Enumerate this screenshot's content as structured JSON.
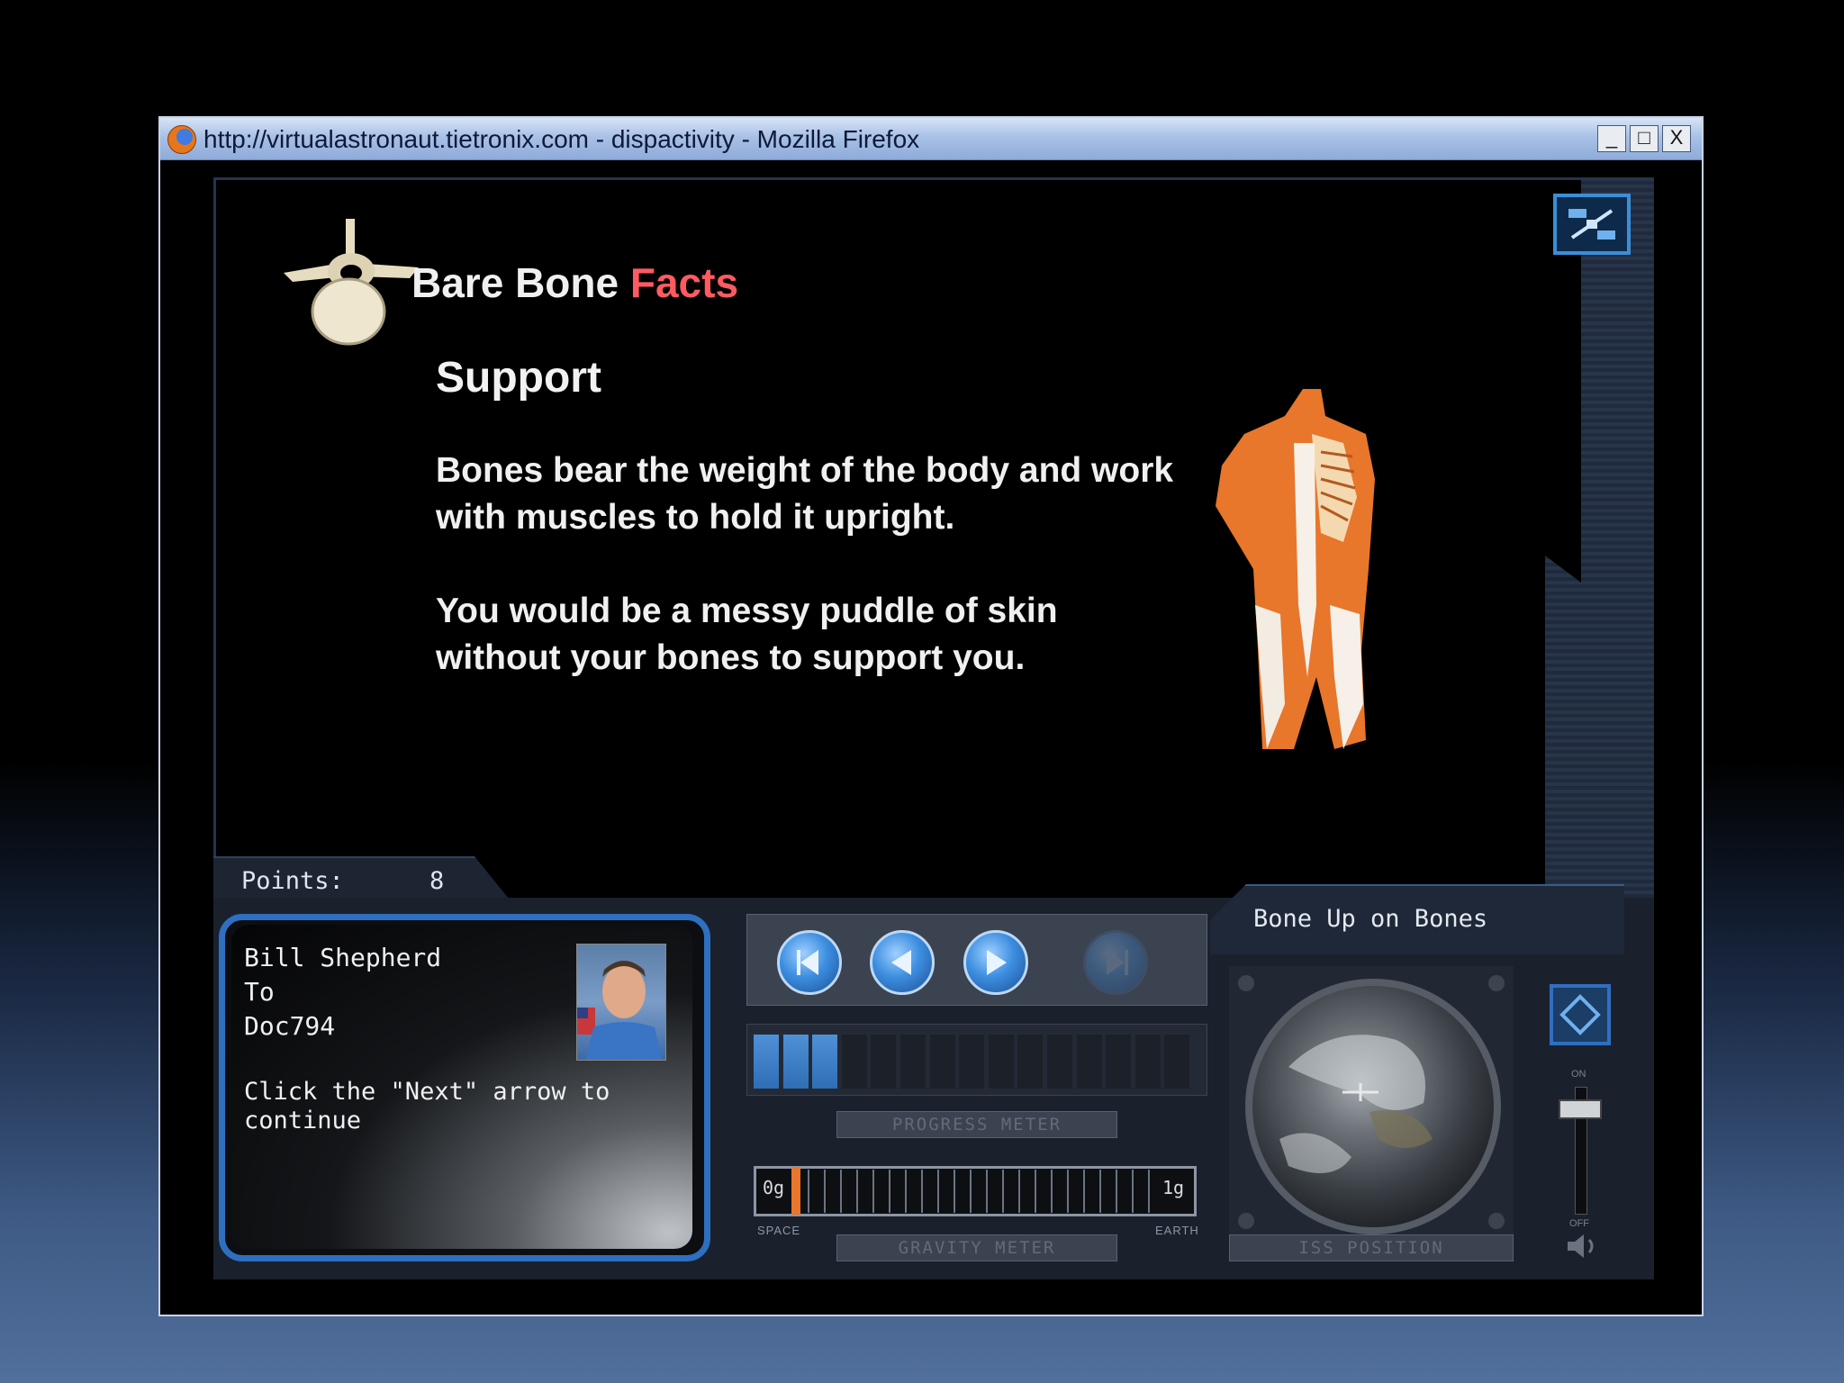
{
  "browser": {
    "title": "http://virtualastronaut.tietronix.com - dispactivity - Mozilla Firefox",
    "controls": {
      "minimize": "_",
      "maximize": "□",
      "close": "X"
    }
  },
  "lesson": {
    "heading_main": "Bare Bone ",
    "heading_highlight": "Facts",
    "subheading": "Support",
    "paragraph_1": "Bones bear the weight of the body and work with muscles to hold it upright.",
    "paragraph_2": "You would be a messy puddle of skin without your bones to support you."
  },
  "points": {
    "label": "Points:",
    "value": "8"
  },
  "message": {
    "from": "Bill Shepherd",
    "to_label": "To",
    "recipient": "Doc794",
    "instruction": "Click the \"Next\" arrow to continue"
  },
  "navigation": {
    "buttons": [
      "first-icon",
      "previous-icon",
      "next-icon",
      "last-icon"
    ],
    "last_enabled": false
  },
  "progress_meter": {
    "label": "PROGRESS METER",
    "filled_segments": 3,
    "total_segments": 15
  },
  "gravity_meter": {
    "label": "GRAVITY METER",
    "min_label": "0g",
    "max_label": "1g",
    "left_caption": "SPACE",
    "right_caption": "EARTH",
    "level": 0.0
  },
  "mission": {
    "title": "Bone Up on Bones"
  },
  "iss_position": {
    "label": "ISS POSITION"
  },
  "volume": {
    "on_label": "ON",
    "off_label": "OFF"
  },
  "colors": {
    "accent_blue": "#2f6fc0",
    "highlight_red": "#ff5a61",
    "muscle_orange": "#e8762b"
  }
}
